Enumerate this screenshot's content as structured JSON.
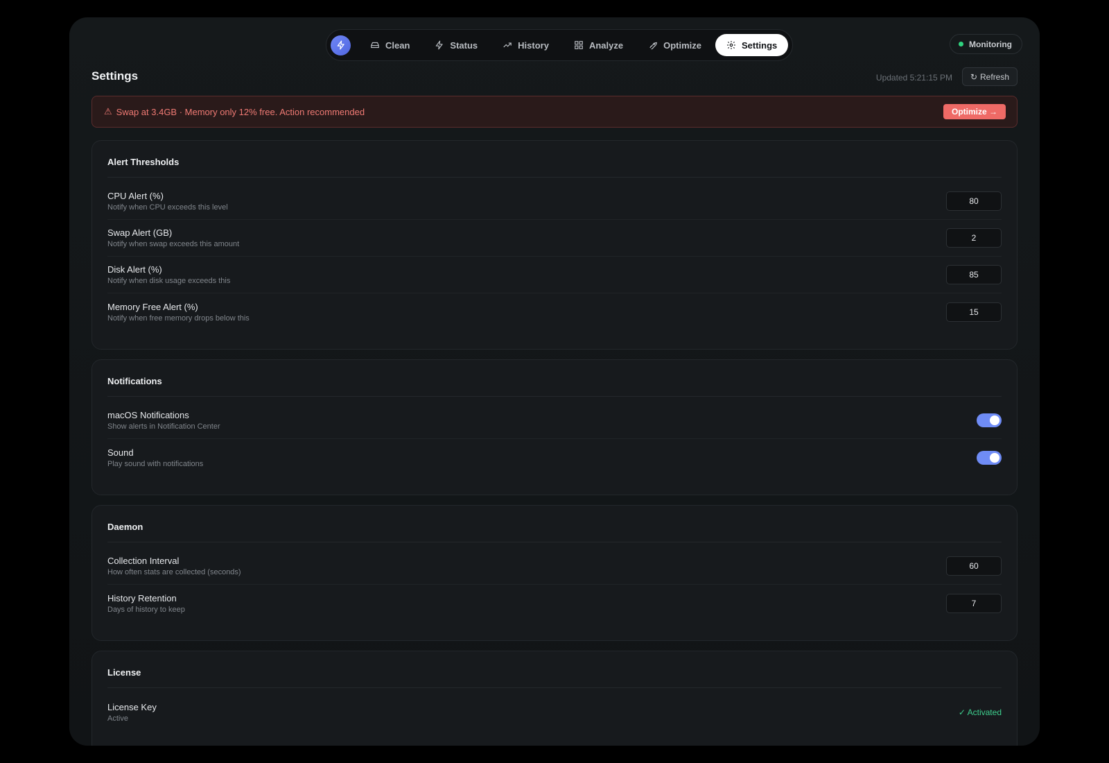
{
  "nav": {
    "tabs": [
      {
        "label": "Clean",
        "icon": "drive-icon"
      },
      {
        "label": "Status",
        "icon": "lightning-icon"
      },
      {
        "label": "History",
        "icon": "trend-icon"
      },
      {
        "label": "Analyze",
        "icon": "grid-icon"
      },
      {
        "label": "Optimize",
        "icon": "rocket-icon"
      },
      {
        "label": "Settings",
        "icon": "gear-icon"
      }
    ],
    "active": "Settings"
  },
  "monitor": {
    "label": "Monitoring",
    "color": "#2fd37e"
  },
  "page": {
    "title": "Settings",
    "updated": "Updated 5:21:15 PM",
    "refresh_label": "Refresh",
    "refresh_icon": "↻"
  },
  "banner": {
    "icon": "⚠",
    "text": "Swap at 3.4GB · Memory only 12% free. Action recommended",
    "button": "Optimize →"
  },
  "alerts": {
    "title": "Alert Thresholds",
    "rows": [
      {
        "label": "CPU Alert (%)",
        "desc": "Notify when CPU exceeds this level",
        "value": "80"
      },
      {
        "label": "Swap Alert (GB)",
        "desc": "Notify when swap exceeds this amount",
        "value": "2"
      },
      {
        "label": "Disk Alert (%)",
        "desc": "Notify when disk usage exceeds this",
        "value": "85"
      },
      {
        "label": "Memory Free Alert (%)",
        "desc": "Notify when free memory drops below this",
        "value": "15"
      }
    ]
  },
  "notifications": {
    "title": "Notifications",
    "rows": [
      {
        "label": "macOS Notifications",
        "desc": "Show alerts in Notification Center",
        "on": true
      },
      {
        "label": "Sound",
        "desc": "Play sound with notifications",
        "on": true
      }
    ]
  },
  "daemon": {
    "title": "Daemon",
    "rows": [
      {
        "label": "Collection Interval",
        "desc": "How often stats are collected (seconds)",
        "value": "60"
      },
      {
        "label": "History Retention",
        "desc": "Days of history to keep",
        "value": "7"
      }
    ]
  },
  "license": {
    "title": "License",
    "rows": [
      {
        "label": "License Key",
        "desc": "Active",
        "status": "✓ Activated"
      }
    ]
  },
  "colors": {
    "accent": "#6f8cf6",
    "danger": "#ef6a66",
    "success": "#3ecf8e"
  }
}
